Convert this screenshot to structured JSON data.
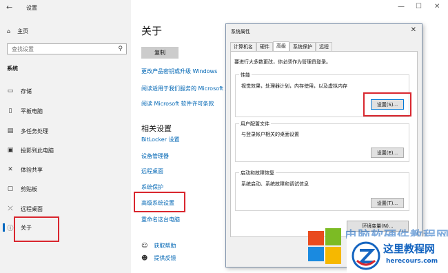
{
  "titlebar": {
    "back_glyph": "←",
    "title": "设置",
    "min": "—",
    "max": "☐",
    "close": "✕"
  },
  "sidebar": {
    "home_label": "主页",
    "search_placeholder": "查找设置",
    "section_label": "系统",
    "items": [
      {
        "label": "存储"
      },
      {
        "label": "平板电脑"
      },
      {
        "label": "多任务处理"
      },
      {
        "label": "投影到此电脑"
      },
      {
        "label": "体验共享"
      },
      {
        "label": "剪贴板"
      },
      {
        "label": "远程桌面"
      },
      {
        "label": "关于"
      }
    ]
  },
  "main": {
    "title": "关于",
    "copy_button": "复制",
    "links": [
      "更改产品密钥或升级 Windows",
      "阅读适用于我们服务的 Microsoft 服",
      "阅读 Microsoft 软件许可条款"
    ],
    "related_heading": "相关设置",
    "related_links": [
      "BitLocker 设置",
      "设备管理器",
      "远程桌面",
      "系统保护",
      "高级系统设置",
      "重命名这台电脑"
    ],
    "help_links": [
      "获取帮助",
      "提供反馈"
    ]
  },
  "dialog": {
    "title": "系统属性",
    "close": "✕",
    "tabs": [
      "计算机名",
      "硬件",
      "高级",
      "系统保护",
      "远程"
    ],
    "active_tab": "高级",
    "admin_note": "要进行大多数更改，你必须作为管理员登录。",
    "performance": {
      "title": "性能",
      "desc": "视觉效果，处理器计划，内存使用，以及虚拟内存",
      "button": "设置(S)..."
    },
    "user_profiles": {
      "title": "用户配置文件",
      "desc": "与登录帐户相关的桌面设置",
      "button": "设置(E)..."
    },
    "startup": {
      "title": "启动和故障恢复",
      "desc": "系统启动、系统故障和调试信息",
      "button": "设置(T)..."
    },
    "env_button": "环境变量(N)..."
  },
  "watermark": {
    "faded_text": "电脑软硬件教程网",
    "badge_text": "这里教程网",
    "badge_url": "herecours.com"
  },
  "colors": {
    "accent": "#0066b4",
    "highlight_box": "#d9262e",
    "sidebar_bg": "#f2f2f2"
  }
}
